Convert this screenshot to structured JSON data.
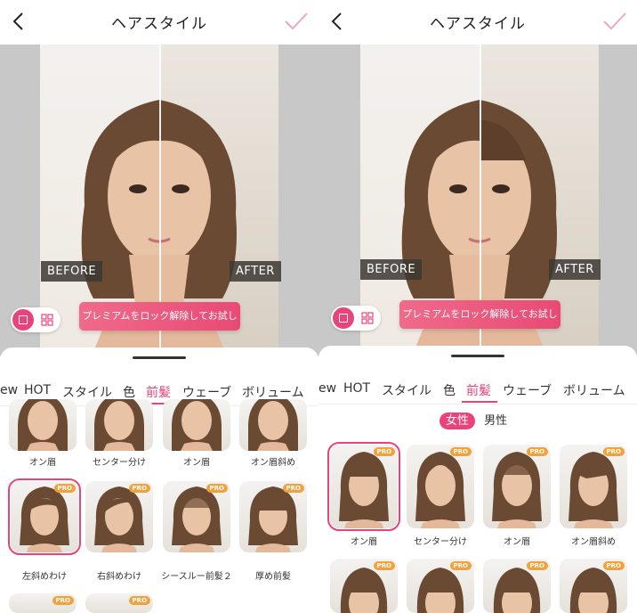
{
  "header": {
    "title": "ヘアスタイル",
    "back_icon": "chevron-left-icon",
    "confirm_icon": "checkmark-icon"
  },
  "photo": {
    "before_label": "BEFORE",
    "after_label": "AFTER"
  },
  "premium_button": "プレミアムをロック解除してお試し",
  "tabs": [
    "ew",
    "HOT",
    "スタイル",
    "色",
    "前髪",
    "ウェーブ",
    "ボリューム"
  ],
  "active_tab": "前髪",
  "gender": {
    "female": "女性",
    "male": "男性"
  },
  "badge": "PRO",
  "left_styles_row1": [
    "オン眉",
    "センター分け",
    "オン眉",
    "オン眉斜め"
  ],
  "left_styles_row2": [
    "左斜めわけ",
    "右斜めわけ",
    "シースルー前髪２",
    "厚め前髪"
  ],
  "right_styles_row1": [
    "オン眉",
    "センター分け",
    "オン眉",
    "オン眉斜め"
  ],
  "colors": {
    "accent": "#e8437a",
    "pro_badge": "#f2a23b"
  }
}
